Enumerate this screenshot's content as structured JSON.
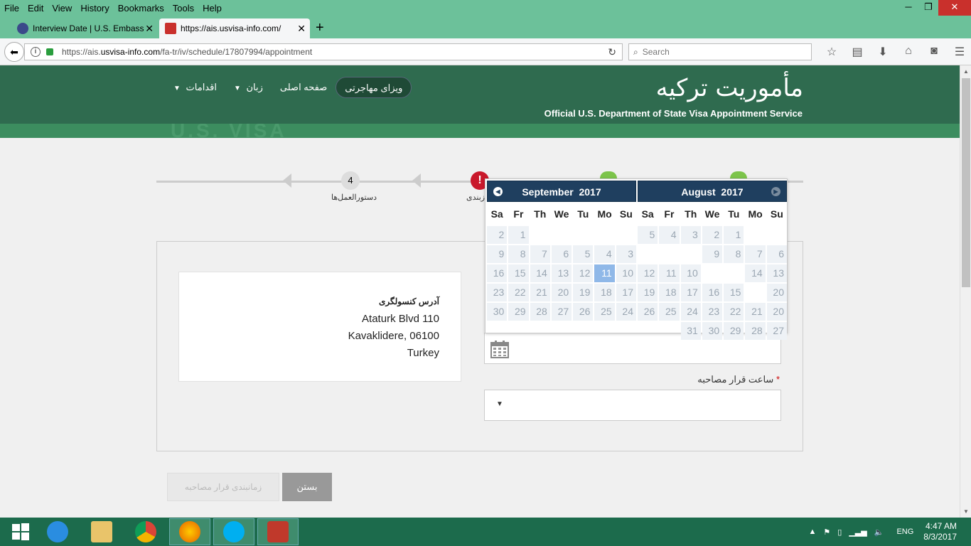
{
  "browser": {
    "menu": [
      "File",
      "Edit",
      "View",
      "History",
      "Bookmarks",
      "Tools",
      "Help"
    ],
    "tabs": [
      {
        "title": "Interview Date | U.S. Embass"
      },
      {
        "title": "https://ais.usvisa-info.com/"
      }
    ],
    "url_prefix": "https://ais.",
    "url_domain": "usvisa-info.com",
    "url_path": "/fa-tr/iv/schedule/17807994/appointment",
    "search_placeholder": "Search"
  },
  "site": {
    "title": "مأموریت ترکیه",
    "subtitle": "Official U.S. Department of State Visa Appointment Service",
    "nav": {
      "immigrant_visa": "ویزای مهاجرتی",
      "home": "صفحه اصلی",
      "language": "زبان",
      "actions": "اقدامات"
    },
    "banner_text": "U.S. VISA"
  },
  "steps": {
    "step4_number": "4",
    "step4_label": "دستورالعمل‌ها",
    "error_icon": "!",
    "error_label": "زبندی"
  },
  "address": {
    "heading": "آدرس کنسولگری",
    "line1": "Ataturk Blvd 110",
    "line2": "Kavaklidere, 06100",
    "line3": "Turkey"
  },
  "form": {
    "time_label": "ساعت قرار مصاحبه",
    "required_mark": "*",
    "schedule_button": "زمانبندی قرار مصاحبه",
    "close_button": "بستن"
  },
  "datepicker": {
    "left": {
      "month": "September",
      "year": "2017",
      "dow": [
        "Sa",
        "Fr",
        "Th",
        "We",
        "Tu",
        "Mo",
        "Su"
      ],
      "weeks": [
        [
          "2",
          "1",
          "",
          "",
          "",
          "",
          ""
        ],
        [
          "9",
          "8",
          "7",
          "6",
          "5",
          "4",
          "3"
        ],
        [
          "16",
          "15",
          "14",
          "13",
          "12",
          "11",
          "10"
        ],
        [
          "23",
          "22",
          "21",
          "20",
          "19",
          "18",
          "17"
        ],
        [
          "30",
          "29",
          "28",
          "27",
          "26",
          "25",
          "24"
        ]
      ]
    },
    "right": {
      "month": "August",
      "year": "2017",
      "dow": [
        "Sa",
        "Fr",
        "Th",
        "We",
        "Tu",
        "Mo",
        "Su"
      ],
      "weeks": [
        [
          "5",
          "4",
          "3",
          "2",
          "1",
          "",
          ""
        ],
        [
          "",
          "",
          "",
          "9",
          "8",
          "7",
          "6"
        ],
        [
          "12",
          "11",
          "10",
          "",
          "",
          "14",
          "13"
        ],
        [
          "19",
          "18",
          "17",
          "16",
          "15",
          "",
          "20"
        ],
        [
          "26",
          "25",
          "24",
          "23",
          "22",
          "21",
          "20"
        ],
        [
          "",
          "",
          "31",
          "30",
          "29",
          "28",
          "27"
        ]
      ]
    },
    "highlighted_day": "11"
  },
  "taskbar": {
    "language": "ENG",
    "time": "4:47 AM",
    "date": "8/3/2017"
  }
}
